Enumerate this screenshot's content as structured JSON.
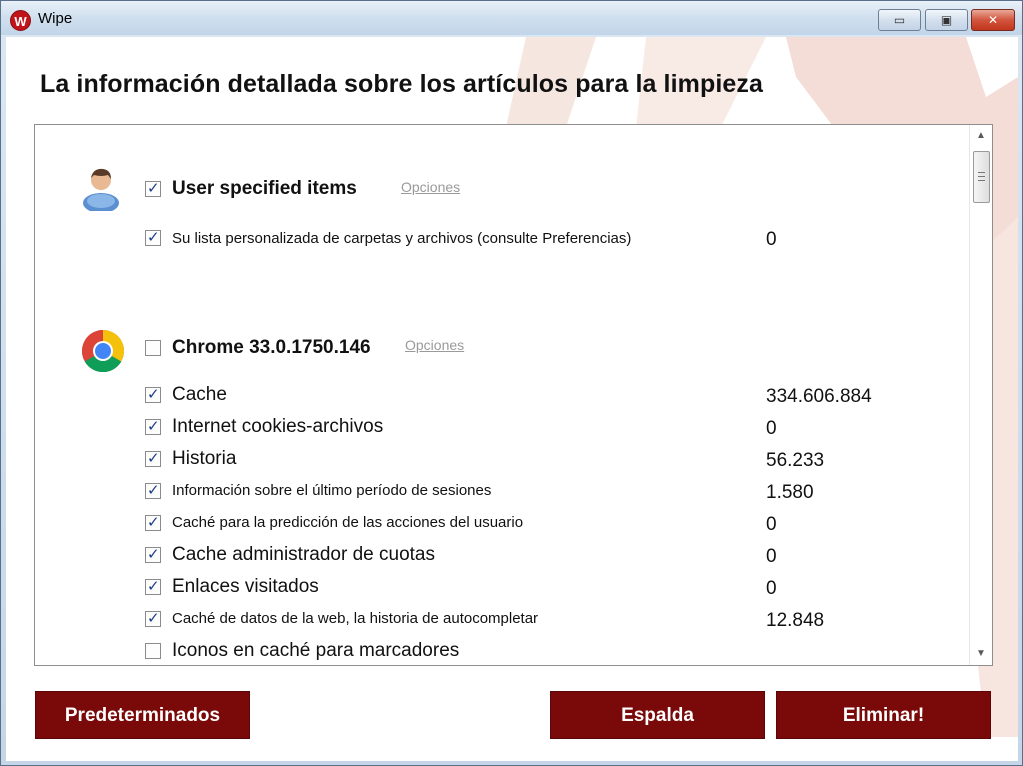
{
  "window": {
    "title": "Wipe",
    "logo_letter": "W",
    "min_glyph": "▭",
    "max_glyph": "▣",
    "close_glyph": "✕"
  },
  "heading": "La información detallada sobre los artículos para la limpieza",
  "groups": [
    {
      "title": "User specified items",
      "options_label": "Opciones",
      "icon": "user-icon",
      "checked": true,
      "items": [
        {
          "label": "Su lista personalizada de carpetas y archivos (consulte Preferencias)",
          "value": "0",
          "checked": true
        }
      ]
    },
    {
      "title": "Chrome 33.0.1750.146",
      "options_label": "Opciones",
      "icon": "chrome-icon",
      "checked": false,
      "items": [
        {
          "label": "Cache",
          "value": "334.606.884",
          "checked": true
        },
        {
          "label": "Internet cookies-archivos",
          "value": "0",
          "checked": true
        },
        {
          "label": "Historia",
          "value": "56.233",
          "checked": true
        },
        {
          "label": "Información sobre el último período de sesiones",
          "value": "1.580",
          "checked": true
        },
        {
          "label": "Caché para la predicción de las acciones del usuario",
          "value": "0",
          "checked": true
        },
        {
          "label": "Cache administrador de cuotas",
          "value": "0",
          "checked": true
        },
        {
          "label": "Enlaces visitados",
          "value": "0",
          "checked": true
        },
        {
          "label": "Caché de datos de la web, la historia de autocompletar",
          "value": "12.848",
          "checked": true
        },
        {
          "label": "Iconos en caché para marcadores",
          "value": "",
          "checked": false
        }
      ]
    }
  ],
  "buttons": {
    "default": "Predeterminados",
    "back": "Espalda",
    "delete": "Eliminar!"
  },
  "colors": {
    "accent": "#7a0a0a",
    "checkmark": "#1c3f8a",
    "link": "#9a9a9a"
  }
}
